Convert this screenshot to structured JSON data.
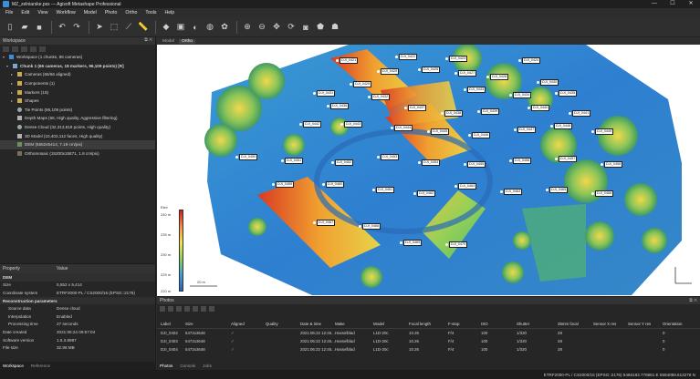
{
  "window": {
    "title": "MZ_zelniarske.psx — Agisoft Metashape Professional",
    "controls": [
      "—",
      "☐",
      "✕"
    ]
  },
  "menu": [
    "File",
    "Edit",
    "View",
    "Workflow",
    "Model",
    "Photo",
    "Ortho",
    "Tools",
    "Help"
  ],
  "workspace": {
    "header": "Workspace",
    "rows": [
      {
        "label": "Workspace (1 chunks, 86 cameras)",
        "icon": "workspace-icon",
        "indent": 0
      },
      {
        "label": "Chunk 1 (66 cameras, 18 markers, 96,109 points) [R]",
        "icon": "chunk-icon",
        "indent": 1,
        "bold": true
      },
      {
        "label": "Cameras (66/66 aligned)",
        "icon": "folder-icon",
        "indent": 2
      },
      {
        "label": "Components (1)",
        "icon": "folder-icon",
        "indent": 2
      },
      {
        "label": "Markers (18)",
        "icon": "folder-icon",
        "indent": 2
      },
      {
        "label": "Shapes",
        "icon": "folder-icon",
        "indent": 2
      },
      {
        "label": "Tie Points (96,109 points)",
        "icon": "tie-points-icon",
        "indent": 2
      },
      {
        "label": "Depth Maps (66, High quality, Aggressive filtering)",
        "icon": "depth-maps-icon",
        "indent": 2
      },
      {
        "label": "Dense Cloud (32,313,819 points, High quality)",
        "icon": "dense-cloud-icon",
        "indent": 2
      },
      {
        "label": "3D Model (10,402,112 faces, High quality)",
        "icon": "model-icon",
        "indent": 2
      },
      {
        "label": "DEM (5552x5414, 7.19 cm/pix)",
        "icon": "dem-icon",
        "indent": 2,
        "selected": true
      },
      {
        "label": "Orthomosaic (15200x15871, 1.8 cm/pix)",
        "icon": "ortho-icon",
        "indent": 2
      }
    ]
  },
  "properties": {
    "col_property": "Property",
    "col_value": "Value",
    "rows": [
      {
        "type": "group",
        "k": "DEM"
      },
      {
        "type": "row",
        "k": "Size",
        "v": "5,552 x 5,414"
      },
      {
        "type": "row",
        "k": "Coordinate system",
        "v": "ETRF2000-PL / CS2000/15 (EPSG::2176)"
      },
      {
        "type": "group",
        "k": "Reconstruction parameters"
      },
      {
        "type": "row",
        "k": "Source data",
        "v": "Dense cloud",
        "ind": true
      },
      {
        "type": "row",
        "k": "Interpolation",
        "v": "Enabled",
        "ind": true
      },
      {
        "type": "row",
        "k": "Processing time",
        "v": "27 seconds",
        "ind": true
      },
      {
        "type": "row",
        "k": "Date created",
        "v": "2021:06:24 09:57:04"
      },
      {
        "type": "row",
        "k": "Software version",
        "v": "1.5.3.8987"
      },
      {
        "type": "row",
        "k": "File size",
        "v": "32.98 MB"
      }
    ]
  },
  "left_tabs": [
    "Workspace",
    "Reference"
  ],
  "view_tabs": [
    "Model",
    "Ortho"
  ],
  "legend": {
    "title": "Elev",
    "ticks": [
      "240 m",
      "235 m",
      "230 m",
      "225 m",
      "220 m"
    ]
  },
  "scale_label": "20 m",
  "markers": [
    "DJI_0421",
    "DJI_0422",
    "DJI_0423",
    "DJI_0424",
    "DJI_0425",
    "DJI_0426",
    "DJI_0427",
    "DJI_0428",
    "DJI_0429",
    "DJI_0430",
    "DJI_0431",
    "DJI_0432",
    "DJI_0433",
    "DJI_0434",
    "DJI_0435",
    "DJI_0436",
    "DJI_0437",
    "DJI_0438",
    "DJI_0439",
    "DJI_0440",
    "DJI_0441",
    "DJI_0442",
    "DJI_0443",
    "DJI_0444",
    "DJI_0445",
    "DJI_0446",
    "DJI_0447",
    "DJI_0448",
    "DJI_0449",
    "DJI_0450",
    "DJI_0451",
    "DJI_0452",
    "DJI_0453",
    "DJI_0454",
    "DJI_0455",
    "DJI_0456",
    "DJI_0457",
    "DJI_0458",
    "DJI_0459",
    "DJI_0460",
    "DJI_0461",
    "DJI_0462",
    "DJI_0463",
    "DJI_0464",
    "DJI_0465",
    "DJI_0466",
    "DJI_0467",
    "DJI_0468",
    "DJI_0469",
    "DJI_0470"
  ],
  "photos": {
    "header": "Photos",
    "columns": [
      "Label",
      "Size",
      "Aligned",
      "Quality",
      "Date & time",
      "Make",
      "Model",
      "Focal length",
      "F-stop",
      "ISO",
      "Shutter",
      "35mm focal",
      "Sensor X res",
      "Sensor Y res",
      "Orientation"
    ],
    "rows": [
      [
        "DJI_0402",
        "5472x3648",
        "✓",
        "",
        "2021:06:22 12:45...",
        "Hasselblad",
        "L1D-20c",
        "10.26",
        "F/4",
        "100",
        "1/320",
        "28",
        "",
        "",
        "0"
      ],
      [
        "DJI_0403",
        "5472x3648",
        "✓",
        "",
        "2021:06:22 12:45...",
        "Hasselblad",
        "L1D-20c",
        "10.26",
        "F/4",
        "100",
        "1/320",
        "28",
        "",
        "",
        "0"
      ],
      [
        "DJI_0404",
        "5472x3648",
        "✓",
        "",
        "2021:06:22 12:45...",
        "Hasselblad",
        "L1D-20c",
        "10.26",
        "F/4",
        "100",
        "1/320",
        "28",
        "",
        "",
        "0"
      ]
    ]
  },
  "right_tabs": [
    "Photos",
    "Console",
    "Jobs"
  ],
  "status": "ETRF2000-PL / CS2000/15 (EPSG::2176)   5466183.778681 E   5594089.613278 N",
  "colors": {
    "accent": "#3a8fd8",
    "bg": "#2b2b2b"
  }
}
